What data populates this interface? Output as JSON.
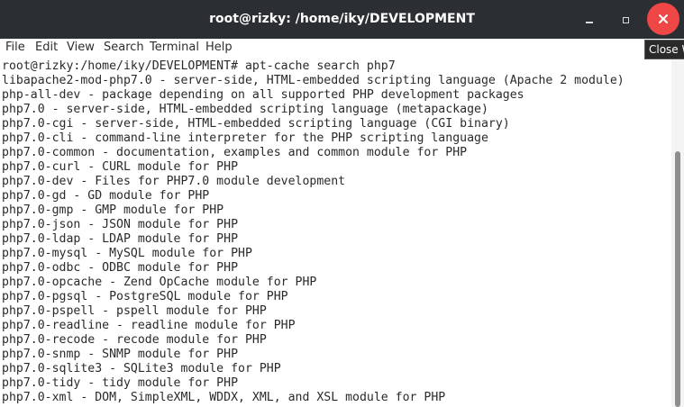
{
  "window": {
    "title": "root@rizky: /home/iky/DEVELOPMENT",
    "close_tooltip": "Close W"
  },
  "menu": [
    {
      "label": "File"
    },
    {
      "label": "Edit"
    },
    {
      "label": "View"
    },
    {
      "label": "Search"
    },
    {
      "label": "Terminal"
    },
    {
      "label": "Help"
    }
  ],
  "terminal": {
    "lines": [
      "root@rizky:/home/iky/DEVELOPMENT# apt-cache search php7",
      "libapache2-mod-php7.0 - server-side, HTML-embedded scripting language (Apache 2 module)",
      "php-all-dev - package depending on all supported PHP development packages",
      "php7.0 - server-side, HTML-embedded scripting language (metapackage)",
      "php7.0-cgi - server-side, HTML-embedded scripting language (CGI binary)",
      "php7.0-cli - command-line interpreter for the PHP scripting language",
      "php7.0-common - documentation, examples and common module for PHP",
      "php7.0-curl - CURL module for PHP",
      "php7.0-dev - Files for PHP7.0 module development",
      "php7.0-gd - GD module for PHP",
      "php7.0-gmp - GMP module for PHP",
      "php7.0-json - JSON module for PHP",
      "php7.0-ldap - LDAP module for PHP",
      "php7.0-mysql - MySQL module for PHP",
      "php7.0-odbc - ODBC module for PHP",
      "php7.0-opcache - Zend OpCache module for PHP",
      "php7.0-pgsql - PostgreSQL module for PHP",
      "php7.0-pspell - pspell module for PHP",
      "php7.0-readline - readline module for PHP",
      "php7.0-recode - recode module for PHP",
      "php7.0-snmp - SNMP module for PHP",
      "php7.0-sqlite3 - SQLite3 module for PHP",
      "php7.0-tidy - tidy module for PHP",
      "php7.0-xml - DOM, SimpleXML, WDDX, XML, and XSL module for PHP"
    ]
  },
  "colors": {
    "titlebar": "#2b2e33",
    "close_button": "#ef4646",
    "terminal_bg": "#ffffff",
    "terminal_fg": "#2a2a2a"
  }
}
